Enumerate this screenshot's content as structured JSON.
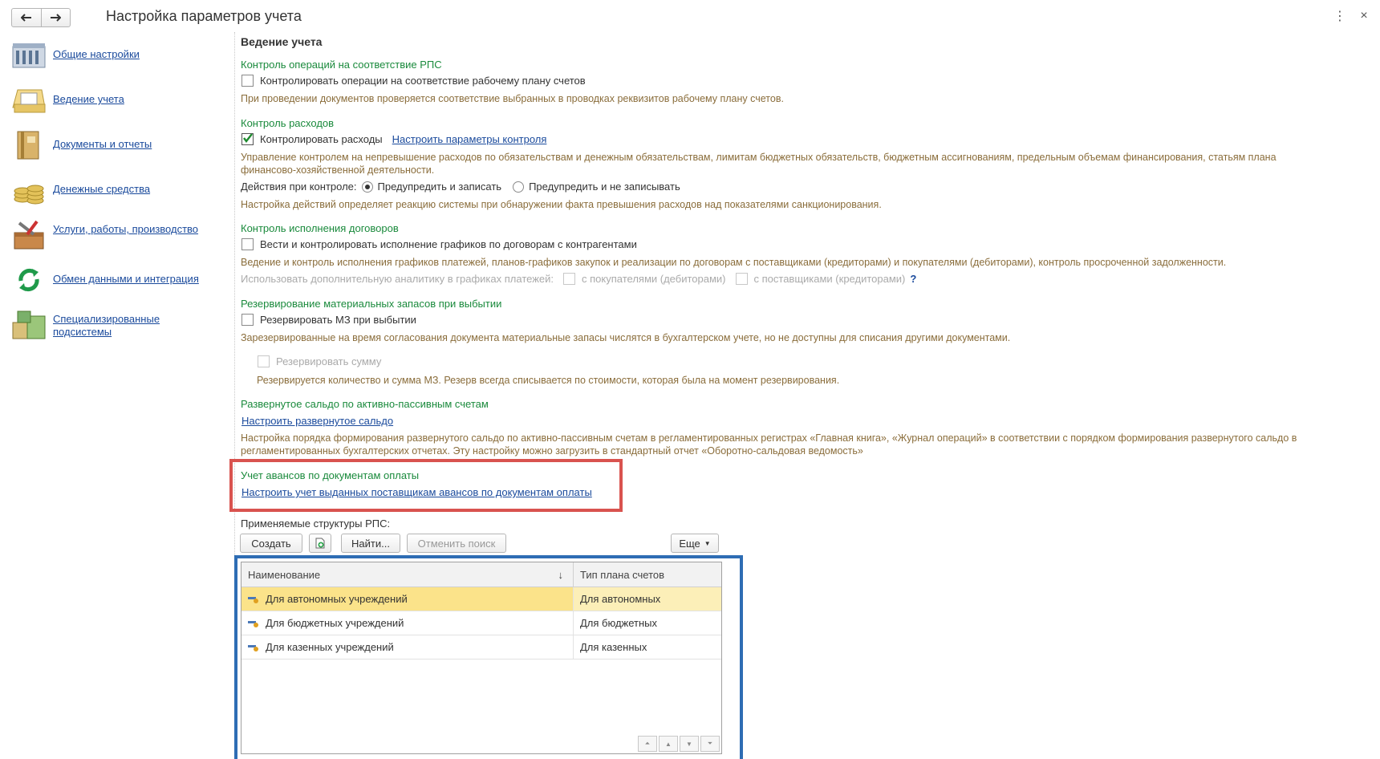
{
  "window": {
    "title": "Настройка параметров учета",
    "back_icon": "arrow-left-icon",
    "forward_icon": "arrow-right-icon",
    "menu_icon": "more-vertical-icon",
    "close_icon": "close-icon"
  },
  "sidebar": {
    "items": [
      {
        "label": "Общие настройки",
        "icon": "building-icon"
      },
      {
        "label": "Ведение учета",
        "icon": "folder-documents-icon"
      },
      {
        "label": "Документы и отчеты",
        "icon": "book-icon"
      },
      {
        "label": "Денежные средства",
        "icon": "coins-icon"
      },
      {
        "label": "Услуги, работы, производство",
        "icon": "toolbox-icon"
      },
      {
        "label": "Обмен данными и интеграция",
        "icon": "sync-icon"
      },
      {
        "label": "Специализированные подсистемы",
        "icon": "boxes-icon"
      }
    ]
  },
  "main": {
    "heading": "Ведение учета",
    "rps_control": {
      "group_title": "Контроль операций на соответствие РПС",
      "checkbox_label": "Контролировать операции на соответствие рабочему плану счетов",
      "hint": "При проведении документов проверяется соответствие выбранных в проводках реквизитов рабочему плану счетов."
    },
    "expense_control": {
      "group_title": "Контроль расходов",
      "checkbox_label": "Контролировать расходы",
      "checked": true,
      "link": "Настроить параметры контроля",
      "hint": "Управление контролем на непревышение расходов по обязательствам и денежным обязательствам, лимитам бюджетных обязательств, бюджетным ассигнованиям, предельным объемам финансирования, статьям плана финансово-хозяйственной деятельности.",
      "actions_label": "Действия при контроле:",
      "option1": "Предупредить и записать",
      "option2": "Предупредить и не записывать",
      "actions_hint": "Настройка действий определяет реакцию системы при обнаружении факта превышения расходов над показателями санкционирования."
    },
    "contract_control": {
      "group_title": "Контроль исполнения договоров",
      "checkbox_label": "Вести и контролировать исполнение графиков по договорам с контрагентами",
      "hint": "Ведение и контроль исполнения графиков платежей, планов-графиков закупок и реализации по договорам с поставщиками (кредиторами) и покупателями (дебиторами), контроль просроченной задолженности.",
      "extra_label": "Использовать дополнительную аналитику в графиках платежей:",
      "extra_opt1": "с покупателями (дебиторами)",
      "extra_opt2": "с поставщиками (кредиторами)",
      "help": "?"
    },
    "reserve": {
      "group_title": "Резервирование материальных запасов при выбытии",
      "checkbox_label": "Резервировать МЗ при выбытии",
      "hint": "Зарезервированные на время согласования документа материальные запасы числятся в бухгалтерском учете, но не доступны для списания другими документами.",
      "sum_label": "Резервировать сумму",
      "sum_hint": "Резервируется количество и сумма МЗ. Резерв всегда списывается по стоимости, которая была на момент резервирования."
    },
    "saldo": {
      "group_title": "Развернутое сальдо по активно-пассивным счетам",
      "link": "Настроить развернутое сальдо",
      "hint": "Настройка порядка формирования развернутого сальдо по активно-пассивным счетам в регламентированных регистрах «Главная книга», «Журнал операций» в соответствии с порядком формирования развернутого сальдо в регламентированных бухгалтерских отчетах. Эту настройку можно загрузить в стандартный отчет «Оборотно-сальдовая ведомость»"
    },
    "advances": {
      "group_title": "Учет авансов по документам оплаты",
      "link": "Настроить учет выданных поставщикам авансов по документам оплаты"
    },
    "structures": {
      "label": "Применяемые структуры РПС:",
      "create_btn": "Создать",
      "add_icon": "add-document-icon",
      "find_btn": "Найти...",
      "cancel_search_btn": "Отменить поиск",
      "more_btn": "Еще",
      "columns": [
        "Наименование",
        "Тип плана счетов"
      ],
      "sort_icon": "↓",
      "rows": [
        {
          "name": "Для автономных учреждений",
          "type": "Для автономных"
        },
        {
          "name": "Для бюджетных учреждений",
          "type": "Для бюджетных"
        },
        {
          "name": "Для казенных учреждений",
          "type": "Для казенных"
        }
      ]
    }
  },
  "colors": {
    "group_title": "#1a8a3c",
    "hint": "#8a6d3b",
    "link": "#1a4a9c",
    "selected_row": "#fbe38a",
    "red_highlight": "#d9534f",
    "blue_highlight": "#2e6db4"
  }
}
